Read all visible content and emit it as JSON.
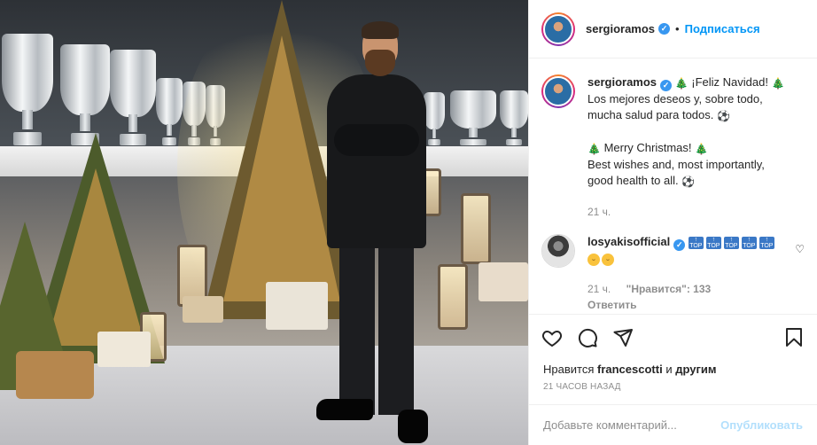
{
  "post_photo": {
    "alt_icon": "photo-christmas-trophies"
  },
  "header": {
    "username": "sergioramos",
    "verified_icon": "verified-badge-icon",
    "separator": "•",
    "follow_label": "Подписаться",
    "more_icon": "more-options-icon"
  },
  "caption": {
    "username": "sergioramos",
    "line1": "¡Feliz Navidad!",
    "line2": "Los mejores deseos y, sobre todo,",
    "line3": "mucha salud para todos.",
    "line4": "Merry Christmas!",
    "line5": "Best wishes and, most importantly,",
    "line6": "good health to all.",
    "time": "21 ч."
  },
  "comment": {
    "username": "losyakisofficial",
    "badges": [
      "TOP",
      "TOP",
      "TOP",
      "TOP",
      "TOP"
    ],
    "time": "21 ч.",
    "likes": "\"Нравится\": 133",
    "reply_label": "Ответить",
    "like_icon": "heart-outline-icon"
  },
  "actions": {
    "like_icon": "heart-icon",
    "comment_icon": "comment-icon",
    "share_icon": "share-icon",
    "save_icon": "bookmark-icon"
  },
  "likes": {
    "prefix": "Нравится",
    "user": "francescotti",
    "and": "и",
    "others": "другим"
  },
  "timestamp": "21 ЧАСОВ НАЗАД",
  "add_comment": {
    "placeholder": "Добавьте комментарий...",
    "publish_label": "Опубликовать"
  },
  "colors": {
    "accent": "#0095f6",
    "verified": "#3897f0",
    "publish_disabled": "#b2dffc",
    "muted": "#8e8e8e"
  }
}
